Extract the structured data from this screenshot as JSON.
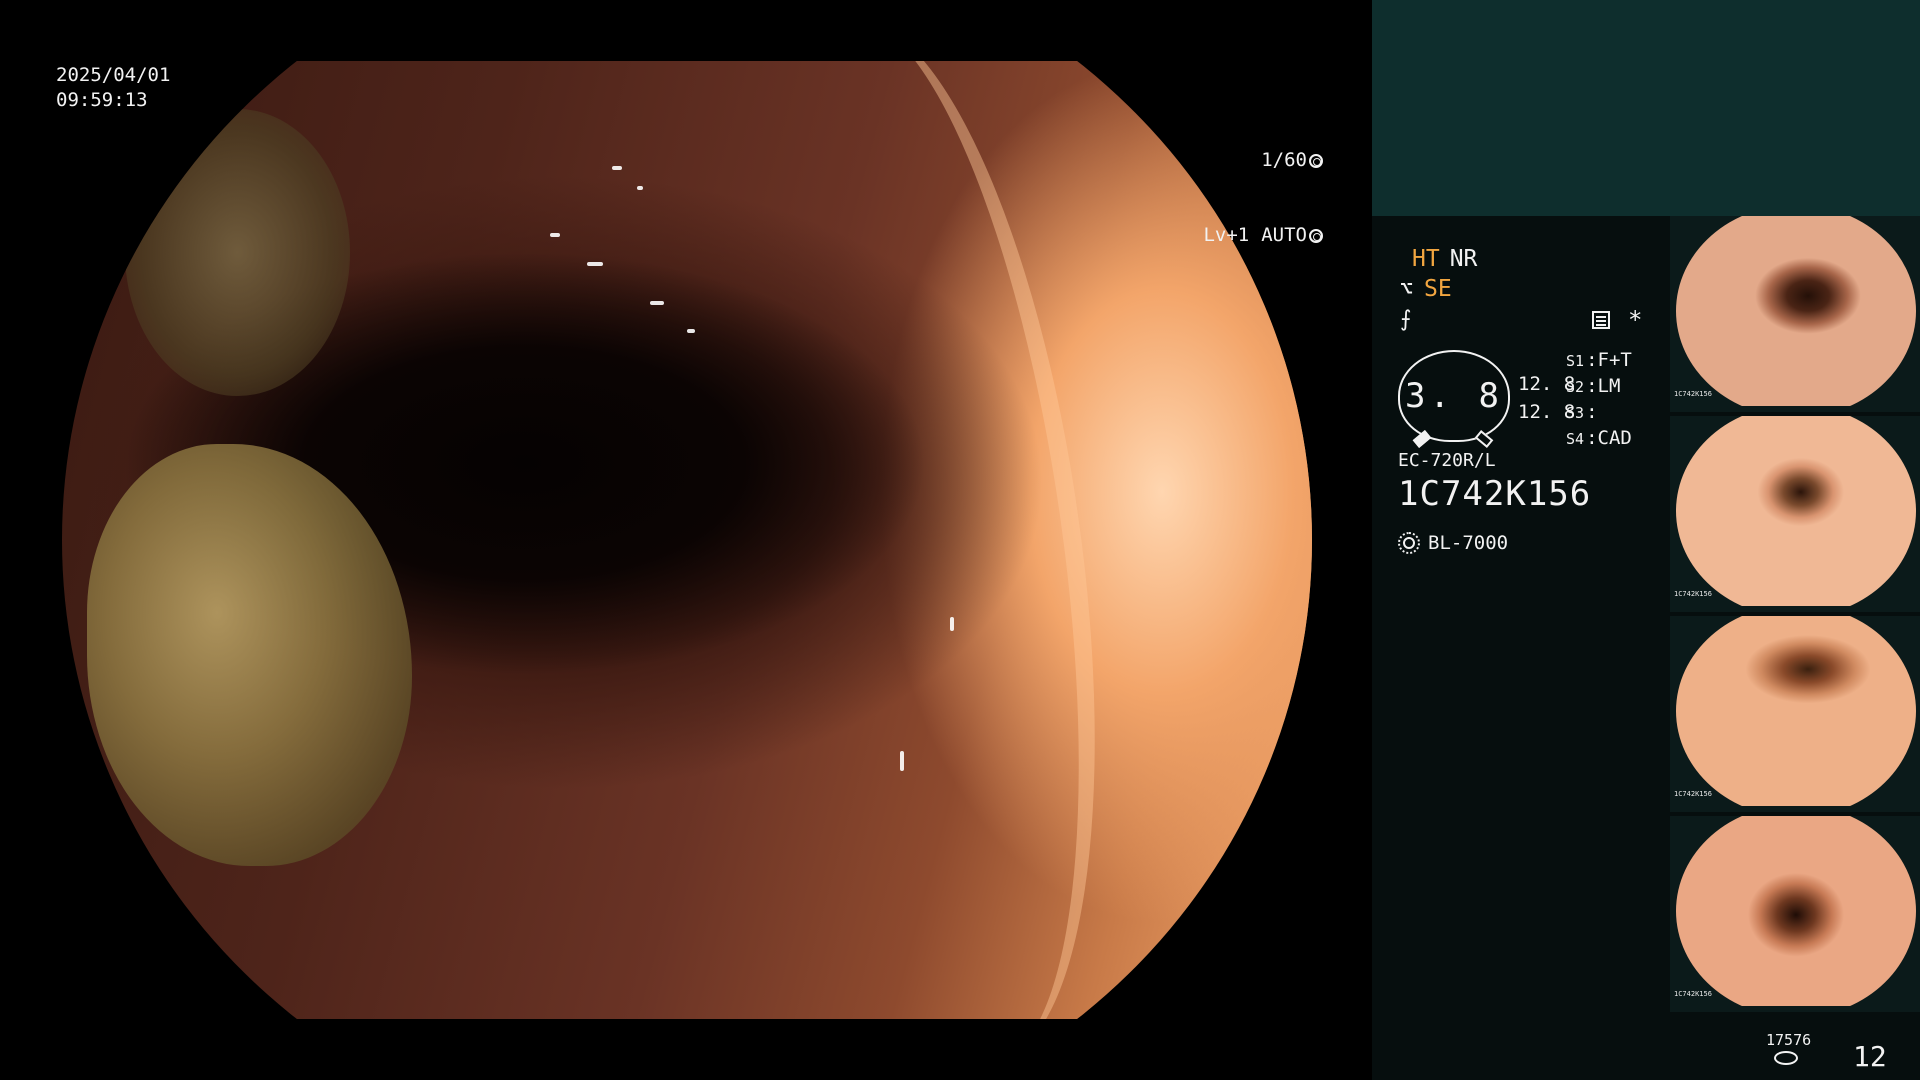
{
  "overlay": {
    "date": "2025/04/01",
    "time": "09:59:13",
    "shutter": "1/60",
    "level": "Lv+1",
    "mode": "AUTO"
  },
  "panel": {
    "ht": "HT",
    "nr": "NR",
    "se": "SE",
    "hook_symbol": "⌥",
    "gauge_symbol": "⨍",
    "asterisk": "*",
    "gauge_value": "3. 8",
    "gauge_vals": [
      "12. 8",
      "12. 8"
    ],
    "settings": [
      {
        "key": "S1",
        "value": "F+T"
      },
      {
        "key": "S2",
        "value": "LM"
      },
      {
        "key": "S3",
        "value": ""
      },
      {
        "key": "S4",
        "value": "CAD"
      }
    ],
    "model": "EC-720R/L",
    "serial": "1C742K156",
    "light_source": "BL-7000",
    "thumb_caption": "1C742K156",
    "image_count": "17576",
    "frame_count": "12"
  },
  "colors": {
    "panel_bg": "#060e0e",
    "header_bg": "#0e2e2d",
    "accent": "#f2a640",
    "text": "#f2f2f2"
  },
  "icons": [
    "shutter-icon",
    "auto-ring-icon",
    "menu-icon",
    "gauge-icon",
    "light-source-icon",
    "disk-icon"
  ]
}
